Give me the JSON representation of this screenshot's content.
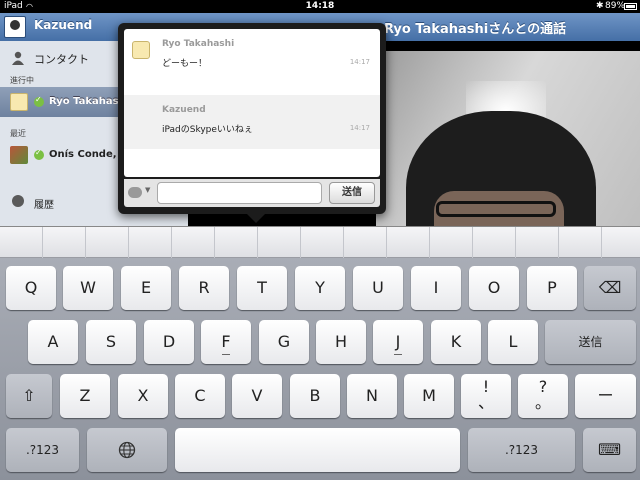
{
  "status_bar": {
    "device": "iPad",
    "time": "14:18",
    "battery": "89%"
  },
  "sidebar": {
    "title": "Kazuend",
    "contacts_label": "コンタクト",
    "section_active": "進行中",
    "section_recent": "最近",
    "active_contact": "Ryo Takahashi",
    "recent_contact": "Onís Conde, José",
    "history_label": "履歴"
  },
  "call": {
    "title": "Ryo Takahashiさんとの通話"
  },
  "chat": {
    "messages": [
      {
        "sender": "Ryo Takahashi",
        "text": "どーもー！",
        "time": "14:17"
      },
      {
        "sender": "Kazuend",
        "text": "iPadのSkypeいいねぇ",
        "time": "14:17"
      }
    ],
    "input_value": "",
    "send_label": "送信"
  },
  "keyboard": {
    "row1": [
      "Q",
      "W",
      "E",
      "R",
      "T",
      "Y",
      "U",
      "I",
      "O",
      "P"
    ],
    "row2": [
      "A",
      "S",
      "D",
      "F",
      "G",
      "H",
      "J",
      "K",
      "L"
    ],
    "row3": [
      "Z",
      "X",
      "C",
      "V",
      "B",
      "N",
      "M"
    ],
    "return_label": "送信",
    "exclaim_top": "!",
    "exclaim_bottom": "、",
    "question_top": "?",
    "question_bottom": "。",
    "dash": "ー",
    "numbers_label": ".?123",
    "globe": "🌐",
    "shift": "⇧",
    "backspace": "⌫",
    "hide": "⌨"
  }
}
